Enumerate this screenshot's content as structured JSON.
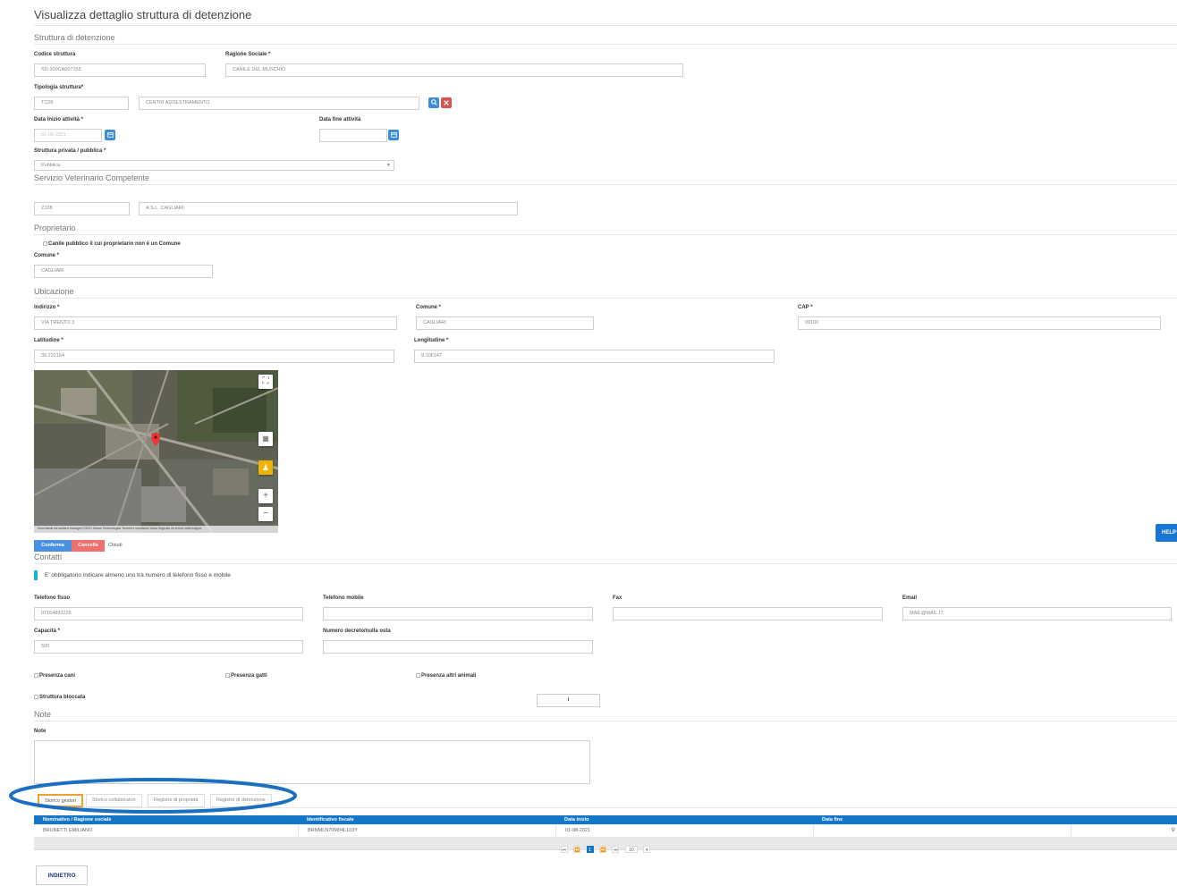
{
  "page": {
    "title": "Visualizza dettaglio struttura di detenzione"
  },
  "sections": {
    "struttura": "Struttura di detenzione",
    "servizio": "Servizio Veterinario Competente",
    "proprietario": "Proprietario",
    "ubicazione": "Ubicazione",
    "contatti": "Contatti",
    "note": "Note"
  },
  "struttura": {
    "codice_label": "Codice struttura",
    "codice_value": "SD-200CA007155",
    "ragione_label": "Ragione Sociale *",
    "ragione_value": "CANILE DEL MUSCHIO",
    "tipologia_label": "Tipologia struttura*",
    "tipologia_code": "TC09",
    "tipologia_desc": "CENTRI ADDESTRAMENTO",
    "search_icon": "search-icon",
    "clear_icon": "close-icon",
    "data_inizio_label": "Data inizio attività *",
    "data_inizio_value": "01-08-2021",
    "data_fine_label": "Data fine attività",
    "data_fine_value": "",
    "privata_label": "Struttura privata / pubblica *",
    "privata_value": "Pubblica"
  },
  "servizio": {
    "code": "Z108",
    "desc": "A.S.L. CAGLIARI"
  },
  "proprietario": {
    "checkbox_label": "Canile pubblico il cui proprietario non è un Comune",
    "comune_label": "Comune *",
    "comune_value": "CAGLIARI"
  },
  "ubicazione": {
    "indirizzo_label": "Indirizzo *",
    "indirizzo_value": "VIA TRENTO 3",
    "comune_label": "Comune *",
    "comune_value": "CAGLIARI",
    "cap_label": "CAP *",
    "cap_value": "09100",
    "lat_label": "Latitudine *",
    "lat_value": "39.222164",
    "lon_label": "Longitudine *",
    "lon_value": "9.106147"
  },
  "map": {
    "attribution": "Scorciatoie da tastiera   Immagini ©2021 Maxar Technologies   Termini e condizioni d'uso   Segnala un errore nella mappa",
    "zoom_in": "+",
    "zoom_out": "−"
  },
  "map_actions": {
    "confirm": "Conferma",
    "cancel": "Cancella",
    "close": "Chiudi"
  },
  "help_button": "HELP",
  "contatti": {
    "info_text": "E' obbligatorio indicare almeno uno tra numero di telefono fisso e mobile",
    "fisso_label": "Telefono fisso",
    "fisso_value": "07154893226",
    "mobile_label": "Telefono mobile",
    "mobile_value": "",
    "fax_label": "Fax",
    "fax_value": "",
    "email_label": "Email",
    "email_value": "MAIL@MAIL.IT",
    "capacita_label": "Capacità *",
    "capacita_value": "500",
    "decreto_label": "Numero decreto/nulla osta",
    "decreto_value": "",
    "cani_label": "Presenza cani",
    "gatti_label": "Presenza gatti",
    "altri_label": "Presenza altri animali",
    "bloccata_label": "Struttura bloccata",
    "info_button": "i"
  },
  "note": {
    "label": "Note",
    "value": ""
  },
  "tabs": [
    "Storico gestori",
    "Storico collaboratori",
    "Registro di proprietà",
    "Registro di detenzione"
  ],
  "table": {
    "headers": [
      "Nominativo / Ragione sociale",
      "Identificativo fiscale",
      "Data inizio",
      "Data fine",
      ""
    ],
    "rows": [
      [
        "BRUNETTI EMILIANO",
        "BRNMLN70M04L103Y",
        "01-08-2021",
        "",
        ""
      ]
    ],
    "pager": {
      "first": "⏮",
      "prev": "⏪",
      "page": "1",
      "next": "⏩",
      "last": "⏭",
      "size": "10"
    }
  },
  "back_button": "INDIETRO",
  "colors": {
    "accent": "#1476c9",
    "danger": "#d9534f",
    "highlight": "#f0a030",
    "annotation": "#1a6fc0"
  }
}
